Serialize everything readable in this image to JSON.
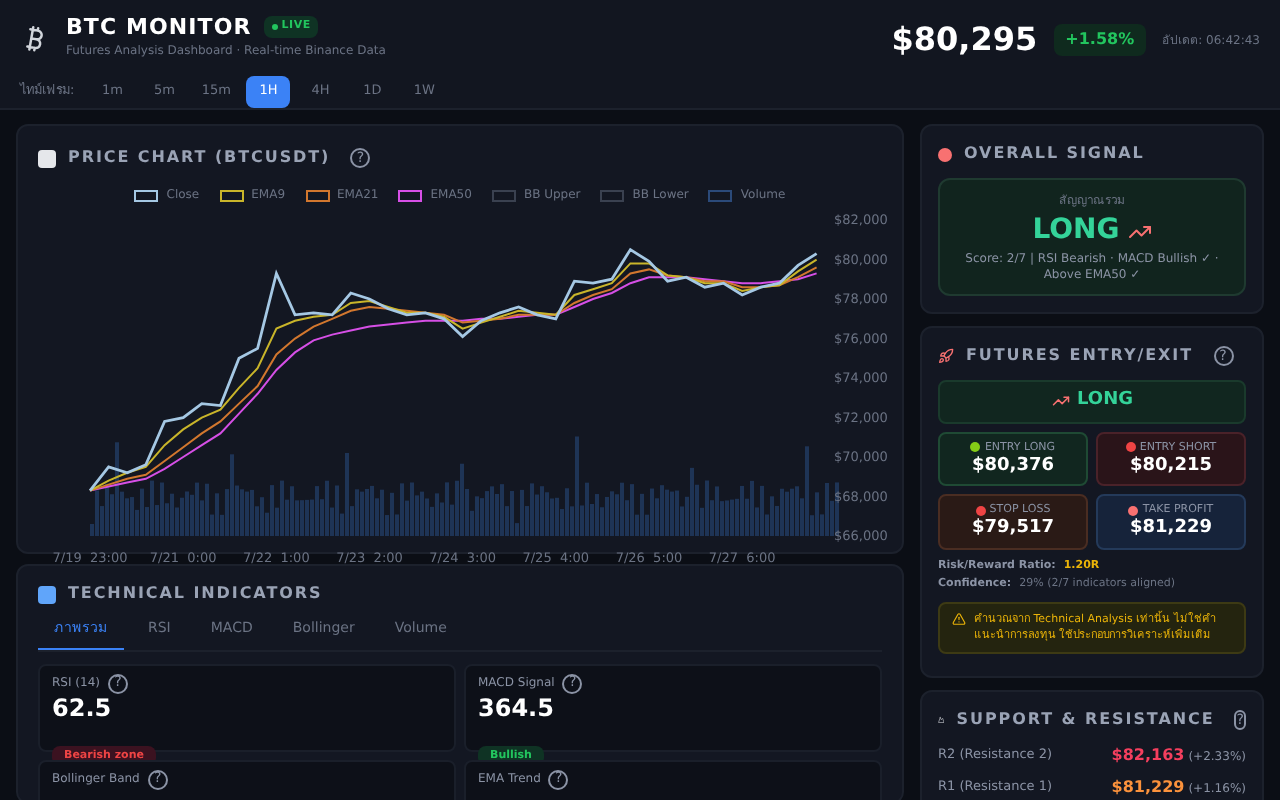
{
  "header": {
    "title": "BTC MONITOR",
    "live_badge": "LIVE",
    "subtitle": "Futures Analysis Dashboard · Real-time Binance Data",
    "price": "$80,295",
    "change": "+1.58%",
    "updated": "อัปเดต: 06:42:43"
  },
  "timeframes": {
    "label": "ไทม์เฟรม:",
    "items": [
      {
        "label": "1m",
        "selected": false
      },
      {
        "label": "5m",
        "selected": false
      },
      {
        "label": "15m",
        "selected": false
      },
      {
        "label": "1H",
        "selected": true
      },
      {
        "label": "4H",
        "selected": false
      },
      {
        "label": "1D",
        "selected": false
      },
      {
        "label": "1W",
        "selected": false
      }
    ]
  },
  "price_chart": {
    "title": "PRICE CHART (BTCUSDT)",
    "help": "?",
    "legend_extra": [
      {
        "label": "BB Upper",
        "color": "#3a4150"
      },
      {
        "label": "BB Lower",
        "color": "#3a4150"
      },
      {
        "label": "Volume",
        "color": "#2b4a7a"
      }
    ],
    "chart_data": {
      "type": "line",
      "categories": [
        "7/19  23:00",
        null,
        null,
        null,
        null,
        "7/21  0:00",
        null,
        null,
        null,
        null,
        "7/22  1:00",
        null,
        null,
        null,
        null,
        "7/23  2:00",
        null,
        null,
        null,
        null,
        "7/24  3:00",
        null,
        null,
        null,
        null,
        "7/25  4:00",
        null,
        null,
        null,
        null,
        "7/26  5:00",
        null,
        null,
        null,
        null,
        "7/27  6:00",
        null,
        null,
        null,
        null
      ],
      "ylim": [
        66000,
        82000
      ],
      "yticks": [
        {
          "value": 66000,
          "label": "$66,000"
        },
        {
          "value": 68000,
          "label": "$68,000"
        },
        {
          "value": 70000,
          "label": "$70,000"
        },
        {
          "value": 72000,
          "label": "$72,000"
        },
        {
          "value": 74000,
          "label": "$74,000"
        },
        {
          "value": 76000,
          "label": "$76,000"
        },
        {
          "value": 78000,
          "label": "$78,000"
        },
        {
          "value": 80000,
          "label": "$80,000"
        },
        {
          "value": 82000,
          "label": "$82,000"
        }
      ],
      "series": [
        {
          "name": "Close",
          "color": "#a5c8e4",
          "values": [
            68300,
            69500,
            69200,
            69600,
            71800,
            72000,
            72700,
            72600,
            75000,
            75500,
            79300,
            77200,
            77300,
            77200,
            78300,
            78000,
            77500,
            77200,
            77300,
            77000,
            76100,
            76900,
            77300,
            77600,
            77200,
            77000,
            78900,
            78800,
            79000,
            80500,
            79900,
            78900,
            79100,
            78600,
            78800,
            78200,
            78600,
            78800,
            79700,
            80300
          ]
        },
        {
          "name": "EMA9",
          "color": "#c9b52a",
          "values": [
            68300,
            68800,
            69200,
            69500,
            70600,
            71400,
            72000,
            72400,
            73500,
            74500,
            76500,
            76900,
            77100,
            77200,
            77800,
            77900,
            77600,
            77300,
            77300,
            77100,
            76500,
            76800,
            77100,
            77400,
            77300,
            77200,
            78200,
            78500,
            78800,
            79800,
            79800,
            79200,
            79100,
            78800,
            78800,
            78400,
            78600,
            78700,
            79400,
            80000
          ]
        },
        {
          "name": "EMA21",
          "color": "#d2772e",
          "values": [
            68300,
            68600,
            68900,
            69100,
            69800,
            70500,
            71200,
            71800,
            72700,
            73600,
            75200,
            76000,
            76600,
            77000,
            77400,
            77600,
            77500,
            77400,
            77300,
            77200,
            76800,
            76900,
            77000,
            77200,
            77200,
            77200,
            77800,
            78200,
            78500,
            79300,
            79500,
            79200,
            79100,
            78900,
            78900,
            78600,
            78600,
            78700,
            79100,
            79600
          ]
        },
        {
          "name": "EMA50",
          "color": "#d64fe6",
          "values": [
            68300,
            68500,
            68700,
            68900,
            69400,
            70000,
            70600,
            71200,
            72200,
            73200,
            74400,
            75300,
            75900,
            76200,
            76400,
            76600,
            76700,
            76800,
            76900,
            76900,
            76900,
            77000,
            77000,
            77100,
            77200,
            77200,
            77600,
            78000,
            78300,
            78800,
            79100,
            79100,
            79100,
            79000,
            78900,
            78800,
            78800,
            78900,
            79000,
            79300
          ]
        }
      ]
    }
  },
  "indicators": {
    "title": "TECHNICAL INDICATORS",
    "tabs": [
      {
        "label": "ภาพรวม",
        "selected": true
      },
      {
        "label": "RSI",
        "selected": false
      },
      {
        "label": "MACD",
        "selected": false
      },
      {
        "label": "Bollinger",
        "selected": false
      },
      {
        "label": "Volume",
        "selected": false
      }
    ],
    "cards": [
      {
        "label": "RSI (14)",
        "help": "?",
        "value": "62.5",
        "badge": "Bearish zone",
        "kind": "bearish"
      },
      {
        "label": "MACD Signal",
        "help": "?",
        "value": "364.5",
        "badge": "Bullish",
        "kind": "bullish"
      },
      {
        "label": "Bollinger Band",
        "help": "?"
      },
      {
        "label": "EMA Trend",
        "help": "?"
      }
    ]
  },
  "overall_signal": {
    "title": "OVERALL SIGNAL",
    "caption": "สัญญาณรวม",
    "signal": "LONG",
    "kind": "long",
    "score": "Score: 2/7 | RSI Bearish · MACD Bullish ✓ · Above EMA50 ✓"
  },
  "futures": {
    "title": "FUTURES ENTRY/EXIT",
    "help": "?",
    "direction": "LONG",
    "kind": "long",
    "levels": [
      {
        "label": "ENTRY LONG",
        "value": "$80,376",
        "kind": "long",
        "color": "#84cc16"
      },
      {
        "label": "ENTRY SHORT",
        "value": "$80,215",
        "kind": "short",
        "color": "#ef4444"
      },
      {
        "label": "STOP LOSS",
        "value": "$79,517",
        "kind": "stop",
        "color": "#ef4444"
      },
      {
        "label": "TAKE PROFIT",
        "value": "$81,229",
        "kind": "target",
        "color": "#f87171"
      }
    ],
    "risk_label": "Risk/Reward Ratio:",
    "risk_value": "1.20R",
    "confidence_label": "Confidence:",
    "confidence_value": "29% (2/7 indicators aligned)",
    "warning": "คำนวณจาก Technical Analysis เท่านั้น ไม่ใช่คำแนะนำการลงทุน ใช้ประกอบการวิเคราะห์เพิ่มเติม"
  },
  "support_resistance": {
    "title": "SUPPORT & RESISTANCE",
    "help": "?",
    "rows": [
      {
        "label": "R2 (Resistance 2)",
        "value": "$82,163",
        "change": "(+2.33%)",
        "color": "#f43f5e"
      },
      {
        "label": "R1 (Resistance 1)",
        "value": "$81,229",
        "change": "(+1.16%)",
        "color": "#fb923c"
      }
    ]
  }
}
